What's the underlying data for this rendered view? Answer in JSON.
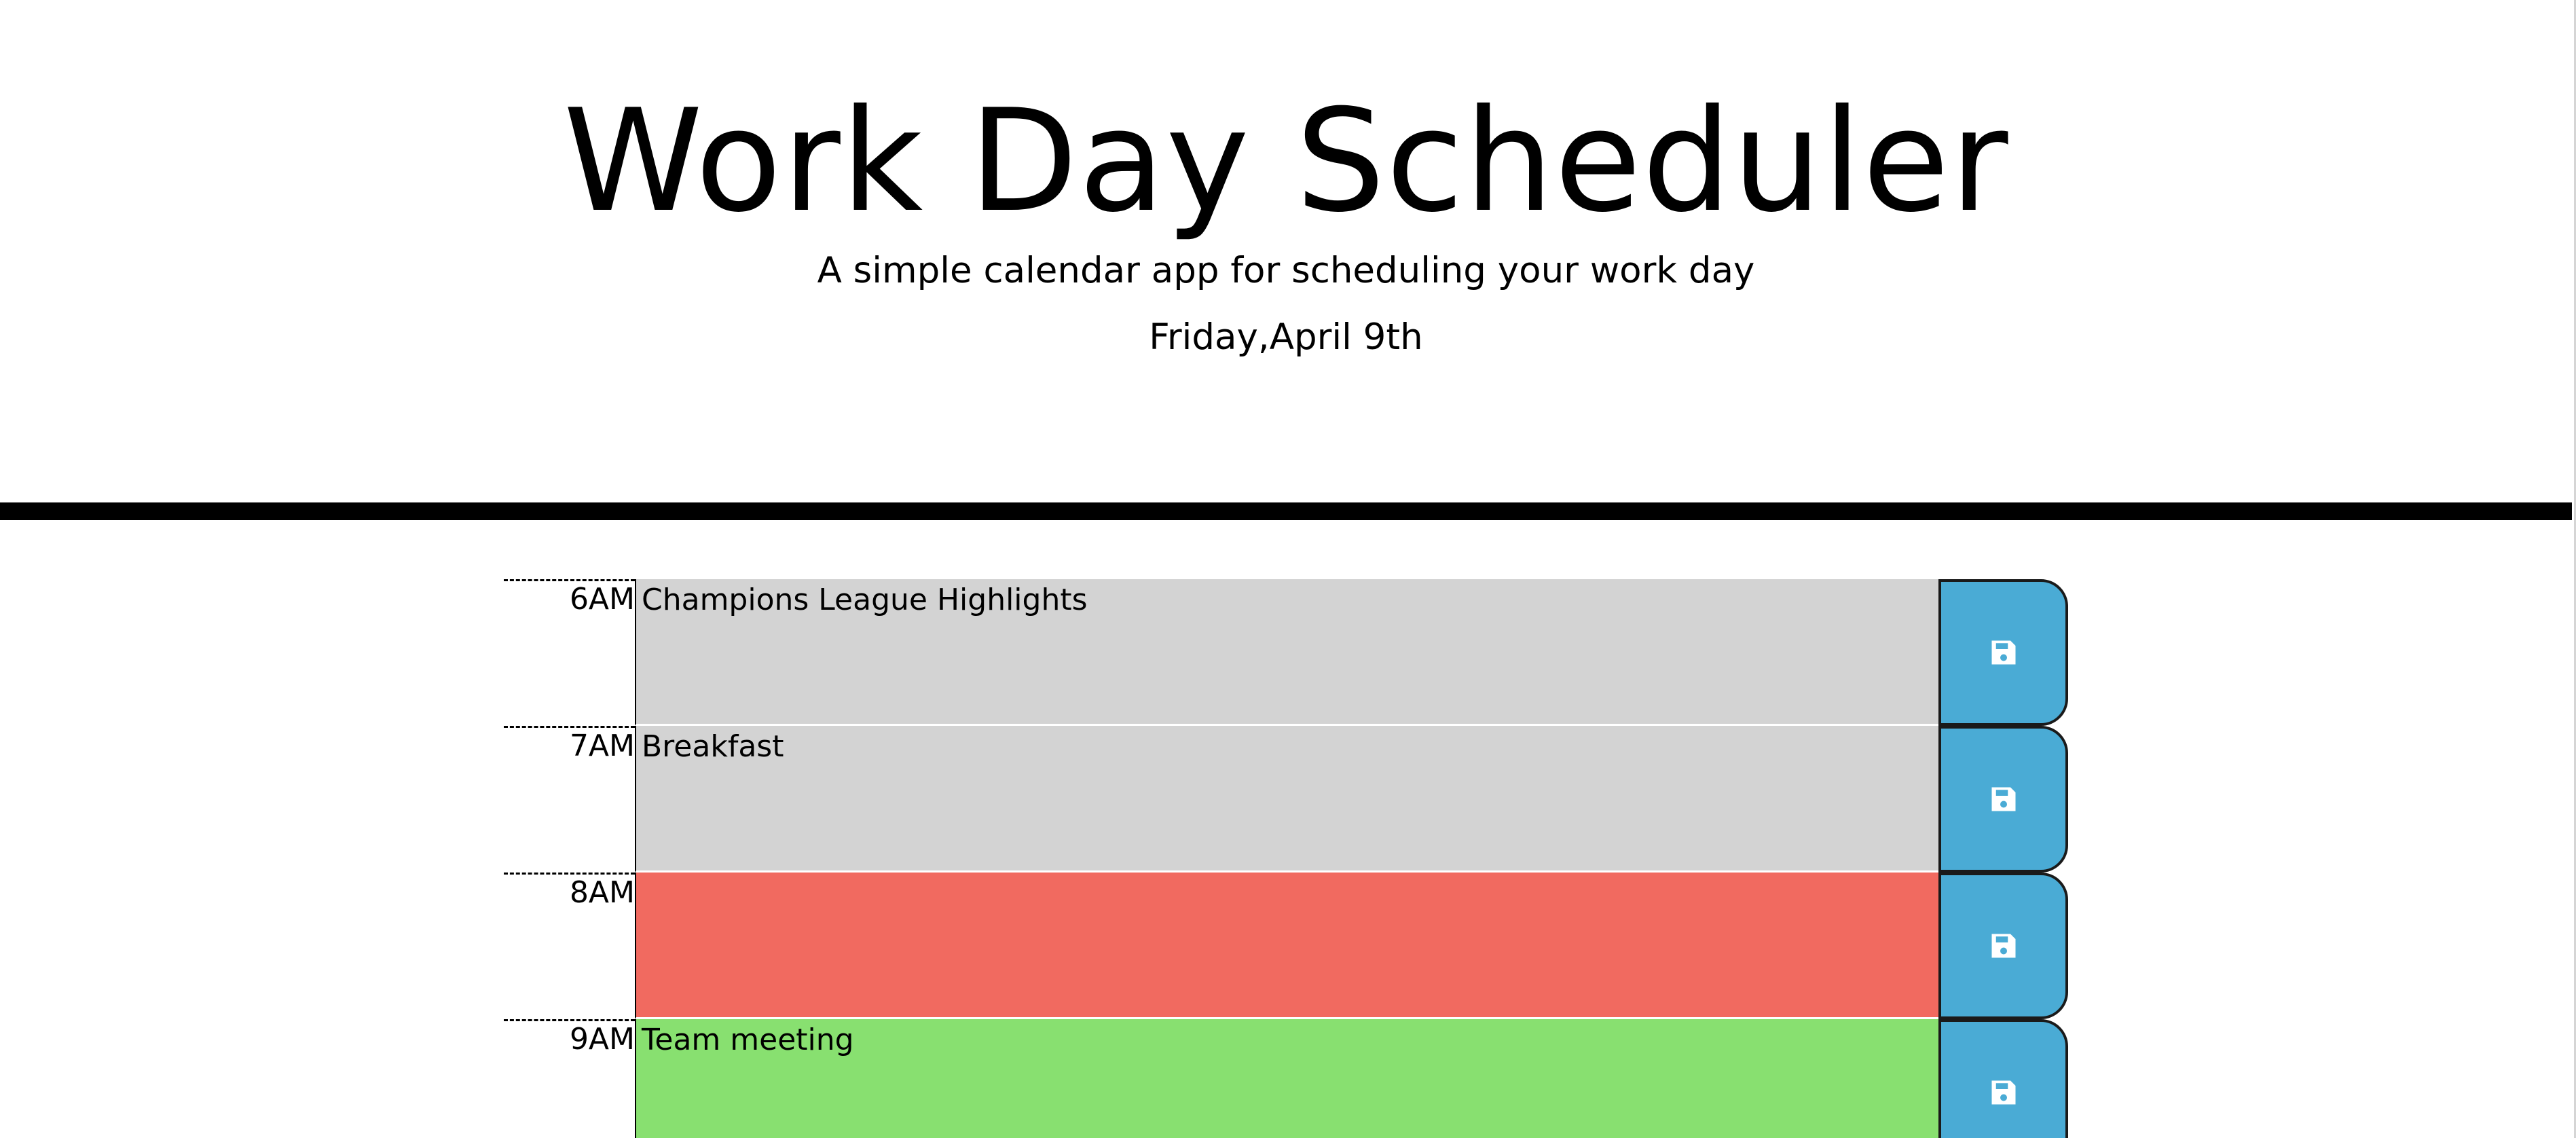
{
  "header": {
    "title": "Work Day Scheduler",
    "subtitle": "A simple calendar app for scheduling your work day",
    "current_day": "Friday,April 9th"
  },
  "colors": {
    "past": "#d3d3d3",
    "present": "#f16a60",
    "future": "#88e070",
    "save_button": "#4aabd5"
  },
  "time_blocks": [
    {
      "hour": "6AM",
      "text": "Champions League Highlights",
      "state": "past",
      "save_icon": "floppy-disk-icon"
    },
    {
      "hour": "7AM",
      "text": "Breakfast",
      "state": "past",
      "save_icon": "floppy-disk-icon"
    },
    {
      "hour": "8AM",
      "text": "",
      "state": "present",
      "save_icon": "floppy-disk-icon"
    },
    {
      "hour": "9AM",
      "text": "Team meeting",
      "state": "future",
      "save_icon": "floppy-disk-icon"
    }
  ]
}
